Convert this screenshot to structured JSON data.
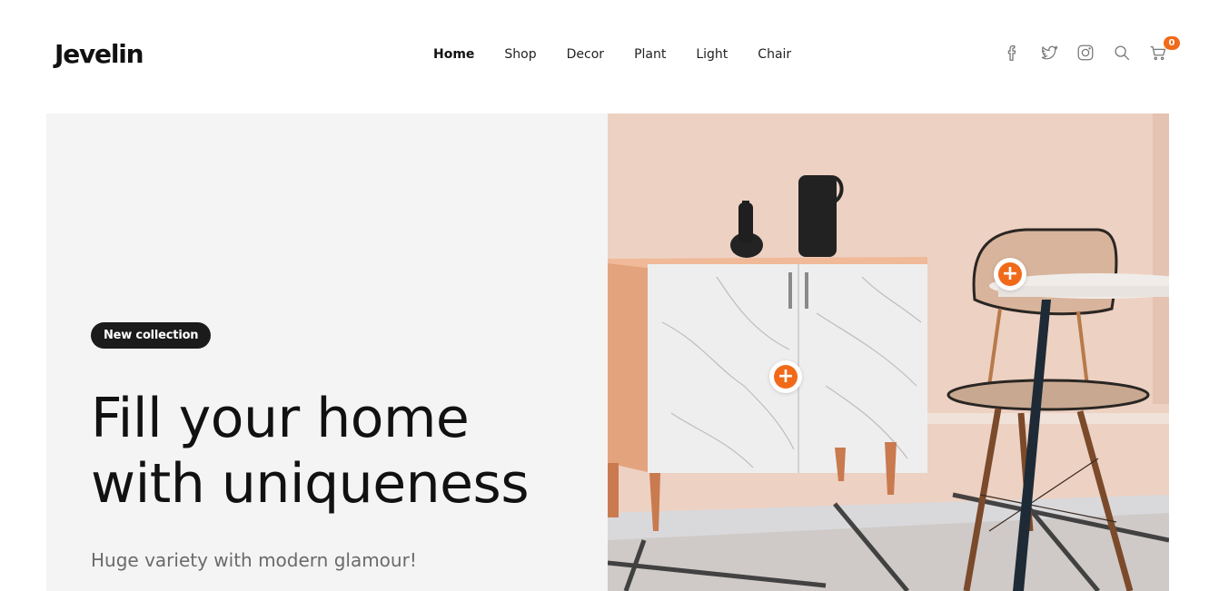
{
  "brand": {
    "logo": "Jevelin"
  },
  "nav": {
    "items": [
      {
        "label": "Home",
        "active": true
      },
      {
        "label": "Shop",
        "active": false
      },
      {
        "label": "Decor",
        "active": false
      },
      {
        "label": "Plant",
        "active": false
      },
      {
        "label": "Light",
        "active": false
      },
      {
        "label": "Chair",
        "active": false
      }
    ]
  },
  "header_icons": {
    "items": [
      "facebook-icon",
      "twitter-icon",
      "instagram-icon",
      "search-icon",
      "cart-icon"
    ],
    "cart_count": "0"
  },
  "hero": {
    "badge": "New collection",
    "headline_line1": "Fill your home",
    "headline_line2": "with uniqueness",
    "subheadline": "Huge variety with modern glamour!"
  },
  "hotspots": {
    "symbol": "+"
  },
  "colors": {
    "accent": "#f06a1a",
    "dark": "#1b1b1b",
    "hero_bg": "#f4f4f4",
    "wall": "#ecd0c1"
  }
}
